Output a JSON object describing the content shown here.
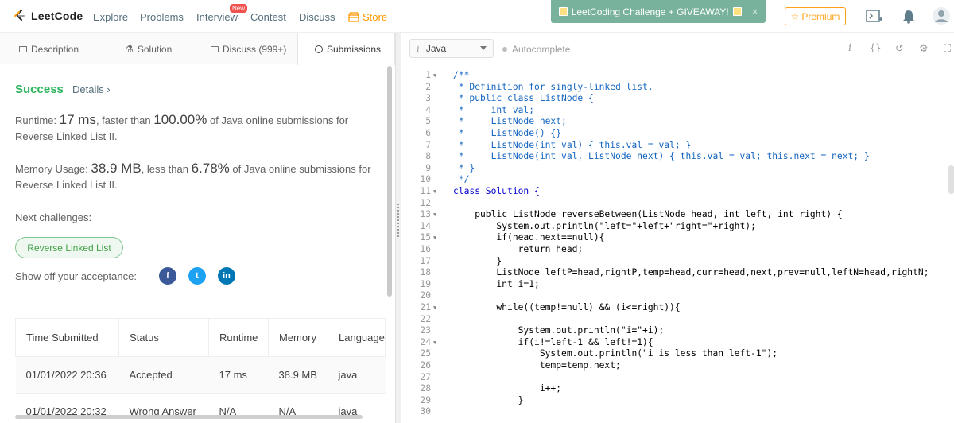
{
  "brand": {
    "name": "LeetCode"
  },
  "nav": {
    "explore": "Explore",
    "problems": "Problems",
    "interview": "Interview",
    "new_badge": "New",
    "contest": "Contest",
    "discuss": "Discuss",
    "store": "Store"
  },
  "banner": {
    "text": "LeetCoding Challenge + GIVEAWAY!",
    "close": "×"
  },
  "premium": {
    "label": "Premium"
  },
  "tabs": {
    "description": "Description",
    "solution": "Solution",
    "discuss": "Discuss (999+)",
    "submissions": "Submissions"
  },
  "result": {
    "status": "Success",
    "details": "Details ›",
    "runtime_label": "Runtime:",
    "runtime_value": "17 ms",
    "runtime_mid": ", faster than",
    "runtime_pct": "100.00%",
    "runtime_tail": "of Java online submissions for",
    "runtime_problem": "Reverse Linked List II.",
    "memory_label": "Memory Usage:",
    "memory_value": "38.9 MB",
    "memory_mid": ", less than",
    "memory_pct": "6.78%",
    "memory_tail": "of Java online submissions for",
    "memory_problem": "Reverse Linked List II.",
    "next_label": "Next challenges:",
    "next_challenge": "Reverse Linked List",
    "show_off": "Show off your acceptance:"
  },
  "social": {
    "facebook": "f",
    "twitter": "t",
    "linkedin": "in"
  },
  "submissions": {
    "headers": [
      "Time Submitted",
      "Status",
      "Runtime",
      "Memory",
      "Language"
    ],
    "rows": [
      {
        "time": "01/01/2022 20:36",
        "status": "Accepted",
        "runtime": "17 ms",
        "memory": "38.9 MB",
        "language": "java"
      },
      {
        "time": "01/01/2022 20:32",
        "status": "Wrong Answer",
        "runtime": "N/A",
        "memory": "N/A",
        "language": "java"
      }
    ]
  },
  "editor": {
    "language": "Java",
    "language_icon": "i",
    "autocomplete": "Autocomplete",
    "lines": [
      {
        "n": "1",
        "fold": true,
        "t": "/**",
        "c": "cm"
      },
      {
        "n": "2",
        "fold": false,
        "t": " * Definition for singly-linked list.",
        "c": "cm"
      },
      {
        "n": "3",
        "fold": false,
        "t": " * public class ListNode {",
        "c": "cm"
      },
      {
        "n": "4",
        "fold": false,
        "t": " *     int val;",
        "c": "cm"
      },
      {
        "n": "5",
        "fold": false,
        "t": " *     ListNode next;",
        "c": "cm"
      },
      {
        "n": "6",
        "fold": false,
        "t": " *     ListNode() {}",
        "c": "cm"
      },
      {
        "n": "7",
        "fold": false,
        "t": " *     ListNode(int val) { this.val = val; }",
        "c": "cm"
      },
      {
        "n": "8",
        "fold": false,
        "t": " *     ListNode(int val, ListNode next) { this.val = val; this.next = next; }",
        "c": "cm"
      },
      {
        "n": "9",
        "fold": false,
        "t": " * }",
        "c": "cm"
      },
      {
        "n": "10",
        "fold": false,
        "t": " */",
        "c": "cm"
      },
      {
        "n": "11",
        "fold": true,
        "t": "class Solution {",
        "c": "kw"
      },
      {
        "n": "12",
        "fold": false,
        "t": "",
        "c": ""
      },
      {
        "n": "13",
        "fold": true,
        "t": "    public ListNode reverseBetween(ListNode head, int left, int right) {",
        "c": ""
      },
      {
        "n": "14",
        "fold": false,
        "t": "        System.out.println(\"left=\"+left+\"right=\"+right);",
        "c": ""
      },
      {
        "n": "15",
        "fold": true,
        "t": "        if(head.next==null){",
        "c": ""
      },
      {
        "n": "16",
        "fold": false,
        "t": "            return head;",
        "c": ""
      },
      {
        "n": "17",
        "fold": false,
        "t": "        }",
        "c": ""
      },
      {
        "n": "18",
        "fold": false,
        "t": "        ListNode leftP=head,rightP,temp=head,curr=head,next,prev=null,leftN=head,rightN;",
        "c": ""
      },
      {
        "n": "19",
        "fold": false,
        "t": "        int i=1;",
        "c": ""
      },
      {
        "n": "20",
        "fold": false,
        "t": "",
        "c": ""
      },
      {
        "n": "21",
        "fold": true,
        "t": "        while((temp!=null) && (i<=right)){",
        "c": ""
      },
      {
        "n": "22",
        "fold": false,
        "t": "",
        "c": ""
      },
      {
        "n": "23",
        "fold": false,
        "t": "            System.out.println(\"i=\"+i);",
        "c": ""
      },
      {
        "n": "24",
        "fold": true,
        "t": "            if(i!=left-1 && left!=1){",
        "c": ""
      },
      {
        "n": "25",
        "fold": false,
        "t": "                System.out.println(\"i is less than left-1\");",
        "c": ""
      },
      {
        "n": "26",
        "fold": false,
        "t": "                temp=temp.next;",
        "c": ""
      },
      {
        "n": "27",
        "fold": false,
        "t": "",
        "c": ""
      },
      {
        "n": "28",
        "fold": false,
        "t": "                i++;",
        "c": ""
      },
      {
        "n": "29",
        "fold": false,
        "t": "            }",
        "c": ""
      },
      {
        "n": "30",
        "fold": false,
        "t": "",
        "c": ""
      }
    ]
  },
  "colors": {
    "accent": "#ffa116",
    "success": "#2db55d",
    "error": "#e53935",
    "banner": "#78b29c",
    "comment": "#1565c0"
  }
}
